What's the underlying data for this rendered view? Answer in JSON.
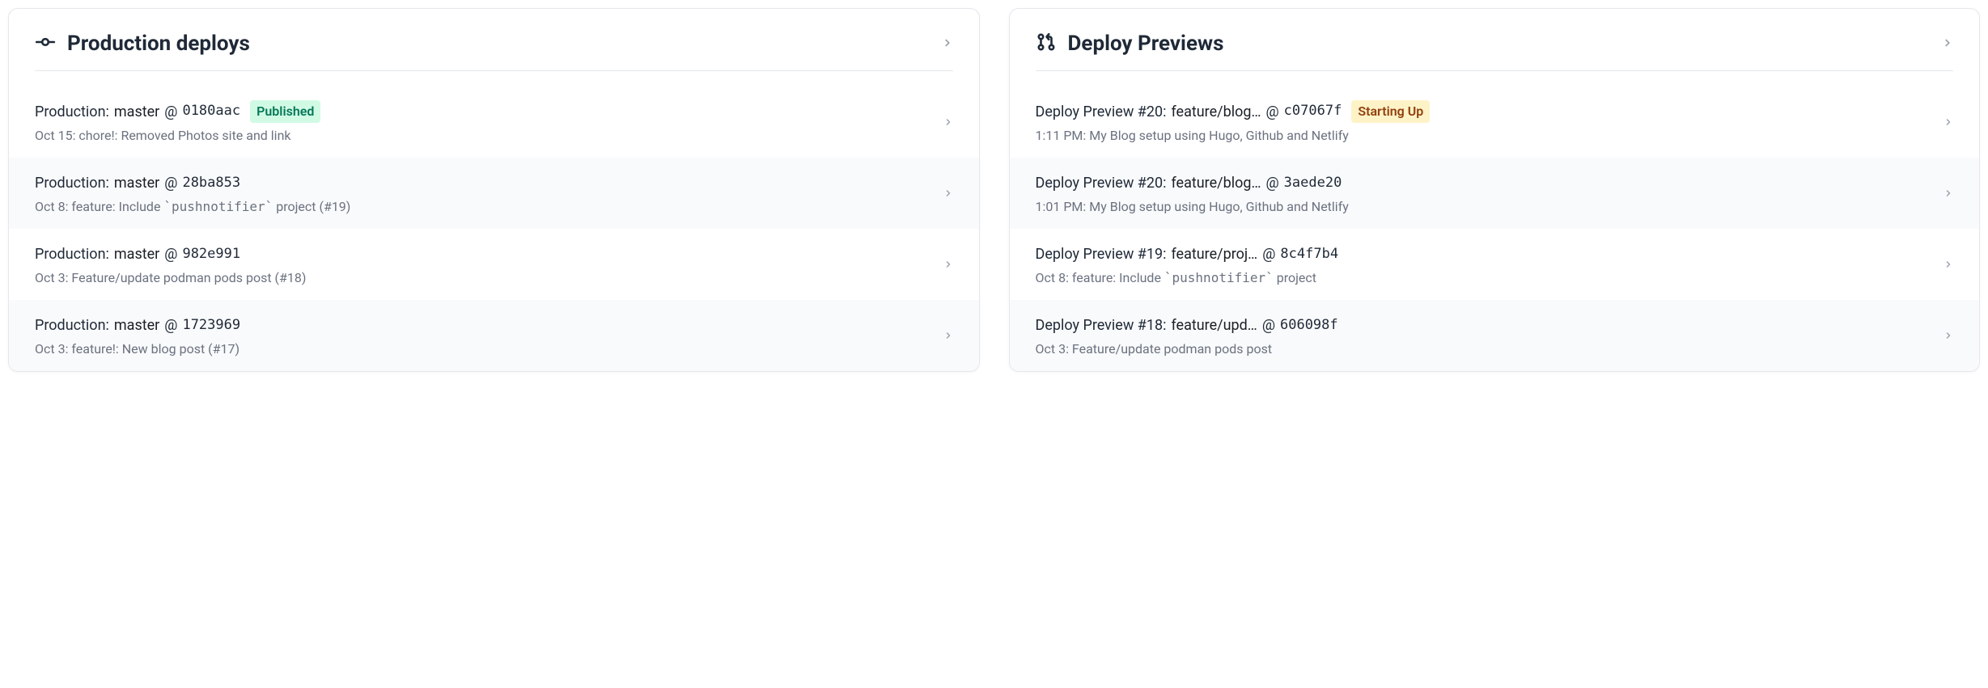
{
  "panels": {
    "production": {
      "title": "Production deploys",
      "items": [
        {
          "prefix": "Production:",
          "branch": "master",
          "hash": "0180aac",
          "status": "Published",
          "status_class": "published",
          "sub": "Oct 15: chore!: Removed Photos site and link"
        },
        {
          "prefix": "Production:",
          "branch": "master",
          "hash": "28ba853",
          "status": "",
          "status_class": "",
          "sub": "Oct 8: feature: Include `pushnotifier` project (#19)"
        },
        {
          "prefix": "Production:",
          "branch": "master",
          "hash": "982e991",
          "status": "",
          "status_class": "",
          "sub": "Oct 3: Feature/update podman pods post (#18)"
        },
        {
          "prefix": "Production:",
          "branch": "master",
          "hash": "1723969",
          "status": "",
          "status_class": "",
          "sub": "Oct 3: feature!: New blog post (#17)"
        }
      ]
    },
    "previews": {
      "title": "Deploy Previews",
      "items": [
        {
          "prefix": "Deploy Preview #20:",
          "branch": "feature/blog…",
          "hash": "c07067f",
          "status": "Starting Up",
          "status_class": "starting",
          "sub": "1:11 PM: My Blog setup using Hugo, Github and Netlify"
        },
        {
          "prefix": "Deploy Preview #20:",
          "branch": "feature/blog…",
          "hash": "3aede20",
          "status": "",
          "status_class": "",
          "sub": "1:01 PM: My Blog setup using Hugo, Github and Netlify"
        },
        {
          "prefix": "Deploy Preview #19:",
          "branch": "feature/proj…",
          "hash": "8c4f7b4",
          "status": "",
          "status_class": "",
          "sub": "Oct 8: feature: Include `pushnotifier` project"
        },
        {
          "prefix": "Deploy Preview #18:",
          "branch": "feature/upd…",
          "hash": "606098f",
          "status": "",
          "status_class": "",
          "sub": "Oct 3: Feature/update podman pods post"
        }
      ]
    }
  }
}
